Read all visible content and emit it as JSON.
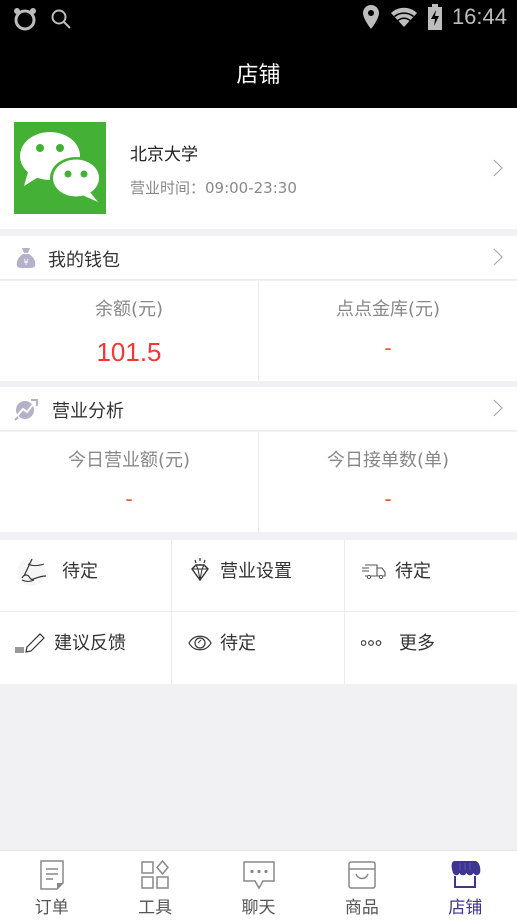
{
  "status_bar": {
    "time": "16:44",
    "icons": [
      "cat-app-icon",
      "search-icon",
      "location-icon",
      "wifi-icon",
      "battery-charging-icon"
    ]
  },
  "app_bar": {
    "title": "店铺"
  },
  "store": {
    "name": "北京大学",
    "hours": "营业时间：09:00-23:30",
    "logo_color": "#44b035"
  },
  "wallet": {
    "title": "我的钱包",
    "stats": [
      {
        "caption": "余额(元)",
        "value": "101.5"
      },
      {
        "caption": "点点金库(元)",
        "value": "-"
      }
    ]
  },
  "analysis": {
    "title": "营业分析",
    "stats": [
      {
        "caption": "今日营业额(元)",
        "value": "-"
      },
      {
        "caption": "今日接单数(单)",
        "value": "-"
      }
    ]
  },
  "grid": [
    {
      "label": "待定",
      "icon": "signature-icon"
    },
    {
      "label": "营业设置",
      "icon": "diamond-icon"
    },
    {
      "label": "待定",
      "icon": "truck-icon"
    },
    {
      "label": "建议反馈",
      "icon": "pencil-icon"
    },
    {
      "label": "待定",
      "icon": "eye-icon"
    },
    {
      "label": "更多",
      "icon": "more-icon"
    }
  ],
  "tabs": [
    {
      "label": "订单",
      "icon": "order-icon",
      "active": false
    },
    {
      "label": "工具",
      "icon": "tools-icon",
      "active": false
    },
    {
      "label": "聊天",
      "icon": "chat-icon",
      "active": false
    },
    {
      "label": "商品",
      "icon": "goods-icon",
      "active": false
    },
    {
      "label": "店铺",
      "icon": "store-icon",
      "active": true
    }
  ],
  "colors": {
    "accent": "#3d3591",
    "balance": "#f03838",
    "dash": "#f4582c",
    "icon_gray": "#b4b1c8"
  }
}
